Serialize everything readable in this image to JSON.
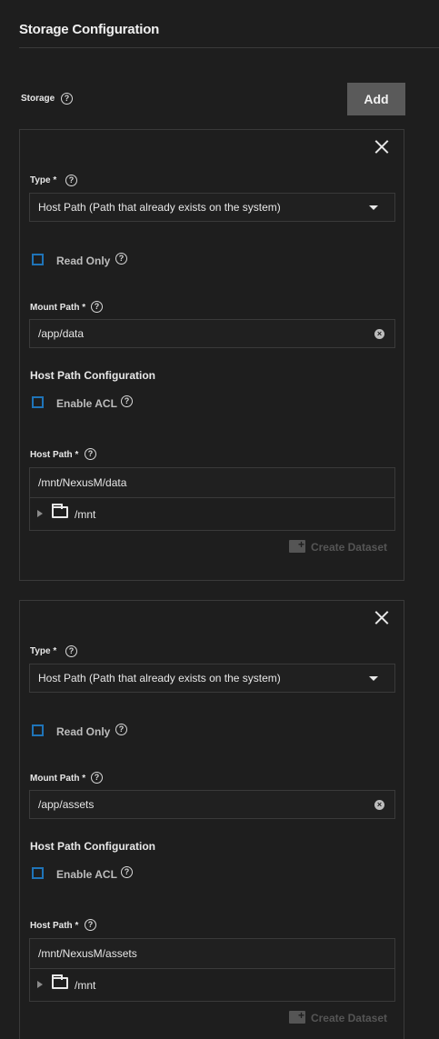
{
  "section": {
    "title": "Storage Configuration"
  },
  "storage": {
    "label": "Storage",
    "add_label": "Add"
  },
  "cards": [
    {
      "type_label": "Type *",
      "type_value": "Host Path (Path that already exists on the system)",
      "read_only_label": "Read Only",
      "mount_path_label": "Mount Path *",
      "mount_path_value": "/app/data",
      "host_path_config_title": "Host Path Configuration",
      "enable_acl_label": "Enable ACL",
      "host_path_label": "Host Path *",
      "host_path_value": "/mnt/NexusM/data",
      "tree_root": "/mnt",
      "create_dataset_label": "Create Dataset"
    },
    {
      "type_label": "Type *",
      "type_value": "Host Path (Path that already exists on the system)",
      "read_only_label": "Read Only",
      "mount_path_label": "Mount Path *",
      "mount_path_value": "/app/assets",
      "host_path_config_title": "Host Path Configuration",
      "enable_acl_label": "Enable ACL",
      "host_path_label": "Host Path *",
      "host_path_value": "/mnt/NexusM/assets",
      "tree_root": "/mnt",
      "create_dataset_label": "Create Dataset"
    }
  ],
  "icons": {
    "help": "?",
    "clear": "×"
  },
  "colors": {
    "background": "#1e1e1e",
    "checkbox_border": "#1f74b8",
    "add_button": "#5a5a5a"
  }
}
